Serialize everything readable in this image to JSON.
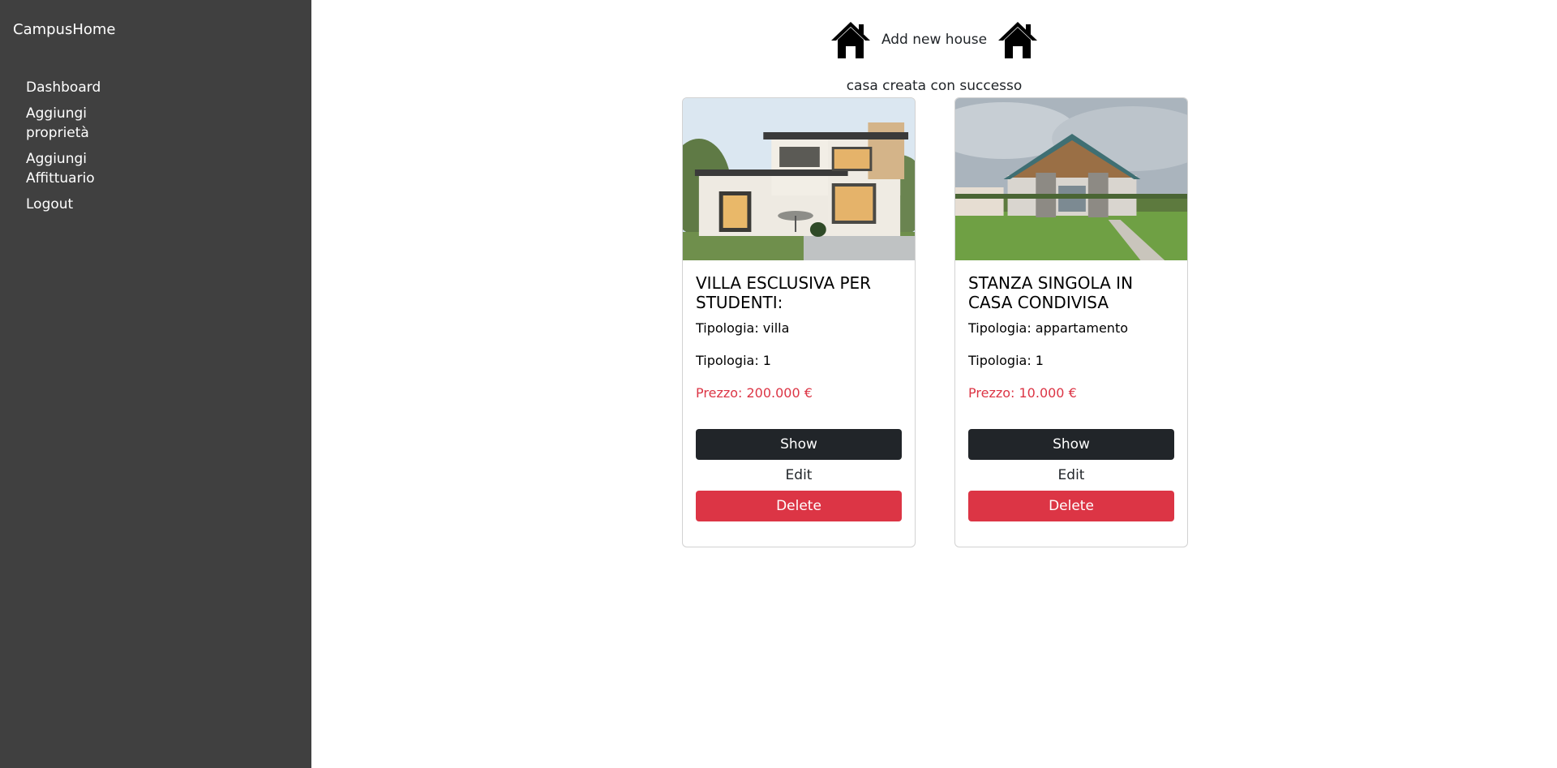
{
  "sidebar": {
    "brand": "CampusHome",
    "items": [
      {
        "label": "Dashboard"
      },
      {
        "label": "Aggiungi proprietà"
      },
      {
        "label": "Aggiungi Affittuario"
      },
      {
        "label": "Logout"
      }
    ]
  },
  "header": {
    "add_label": "Add new house",
    "left_icon": "house-icon",
    "right_icon": "house-icon"
  },
  "flash": "casa creata con successo",
  "cards": [
    {
      "title": "VILLA ESCLUSIVA PER STUDENTI:",
      "tipologia": "Tipologia: villa",
      "tipologia2": "Tipologia: 1",
      "price": "Prezzo: 200.000 €",
      "show_label": "Show",
      "edit_label": "Edit",
      "delete_label": "Delete"
    },
    {
      "title": "STANZA SINGOLA IN CASA CONDIVISA",
      "tipologia": "Tipologia: appartamento",
      "tipologia2": "Tipologia: 1",
      "price": "Prezzo: 10.000 €",
      "show_label": "Show",
      "edit_label": "Edit",
      "delete_label": "Delete"
    }
  ],
  "colors": {
    "sidebar": "#404040",
    "dark_button": "#212529",
    "danger": "#dc3545"
  }
}
